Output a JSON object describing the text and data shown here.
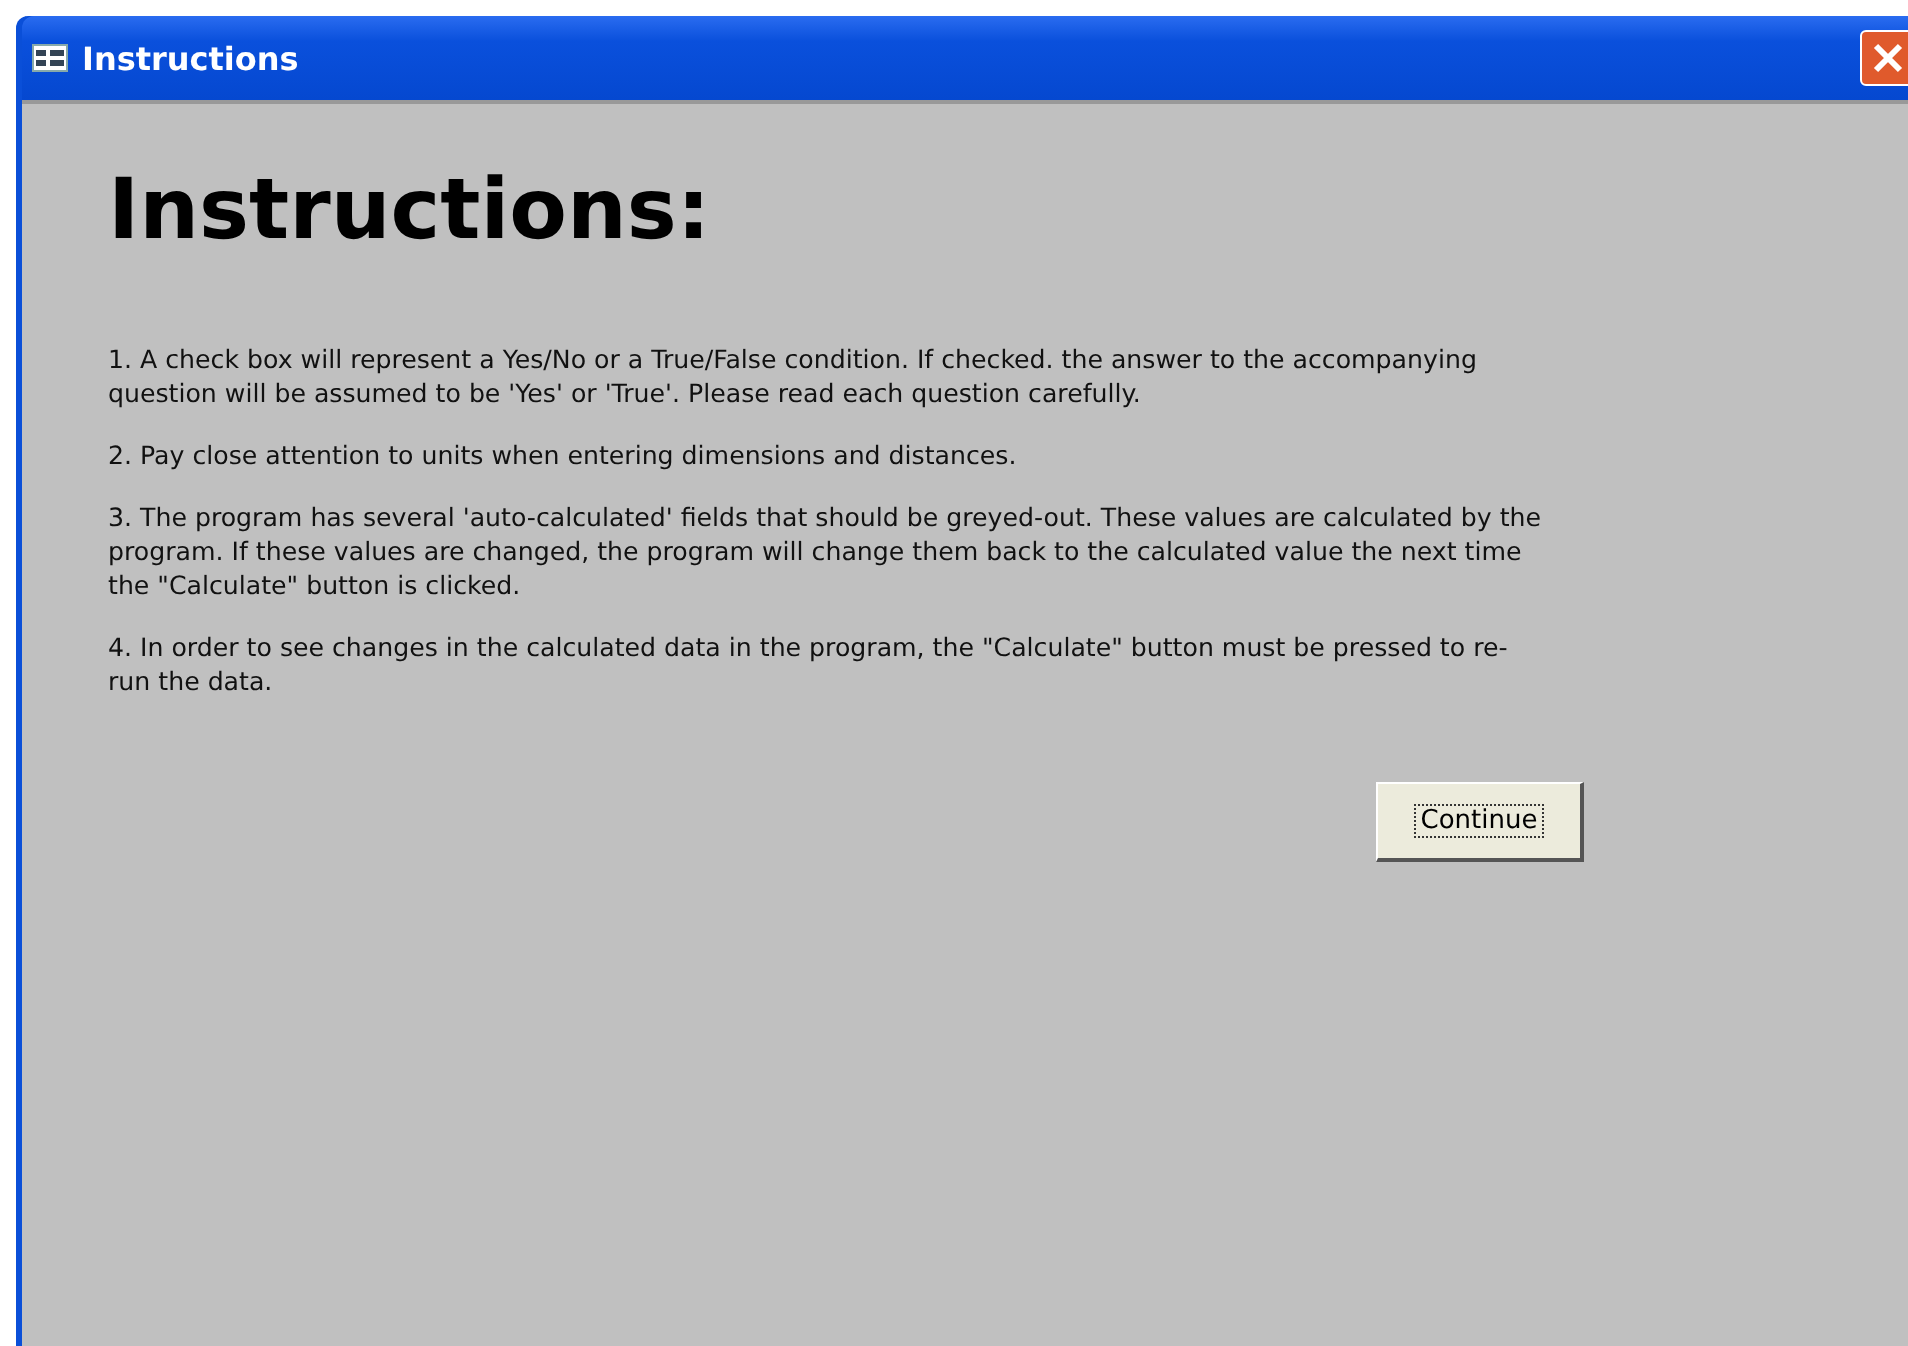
{
  "window": {
    "title": "Instructions"
  },
  "heading": "Instructions:",
  "paragraphs": [
    "1.  A check box will represent a Yes/No or a True/False condition. If checked. the answer to the accompanying question will be assumed to be 'Yes' or 'True'.  Please read each question carefully.",
    "2.  Pay close attention to units when entering dimensions and distances.",
    "3.  The program has several 'auto-calculated' fields that should be greyed-out.  These values are calculated by the program.  If these values are changed, the program will change them back to the calculated value the next time the \"Calculate\" button is clicked.",
    "4.  In order to see changes in the calculated data in the program, the \"Calculate\" button must be pressed to re-run the data."
  ],
  "buttons": [
    {
      "label": "Continue",
      "focused": true
    }
  ]
}
